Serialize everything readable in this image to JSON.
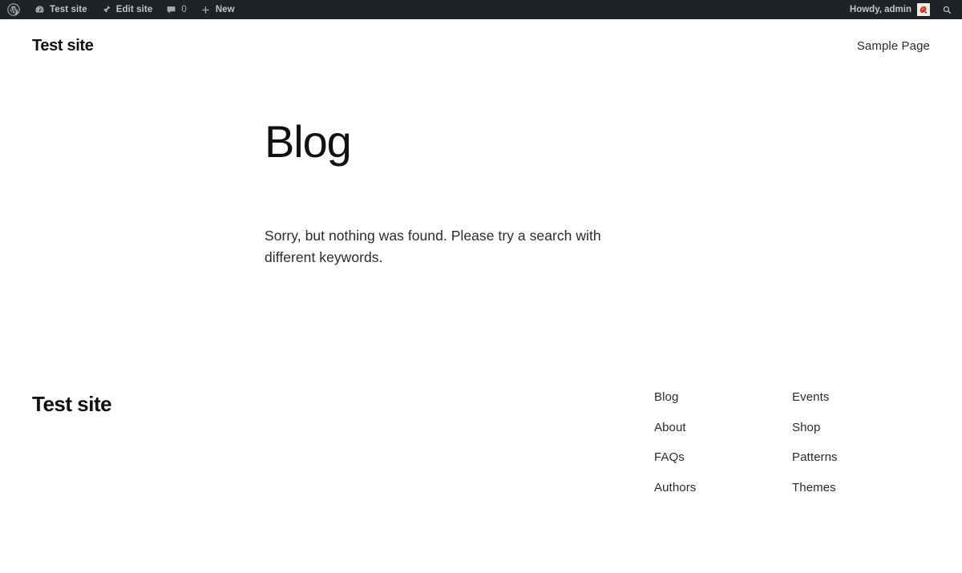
{
  "adminbar": {
    "wp_logo_label": "About WordPress",
    "items": [
      {
        "icon": "wordpress-logo-icon",
        "label": ""
      },
      {
        "icon": "dashboard-icon",
        "label": "Test site"
      },
      {
        "icon": "pushpin-icon",
        "label": "Edit site"
      },
      {
        "icon": "comment-bubble-icon",
        "label": "0"
      },
      {
        "icon": "plus-icon",
        "label": "New"
      }
    ],
    "site_name": "Test site",
    "edit_site": "Edit site",
    "comment_count": "0",
    "new_label": "New",
    "howdy": "Howdy, admin",
    "avatar_alt": "admin avatar",
    "search_icon": "search-icon",
    "background": "#1d2327",
    "text_color": "#c3c4c7"
  },
  "header": {
    "site_title": "Test site",
    "nav": [
      {
        "label": "Sample Page"
      }
    ]
  },
  "main": {
    "page_title": "Blog",
    "no_results": "Sorry, but nothing was found. Please try a search with different keywords."
  },
  "footer": {
    "site_title": "Test site",
    "columns": [
      {
        "links": [
          {
            "label": "Blog"
          },
          {
            "label": "About"
          },
          {
            "label": "FAQs"
          },
          {
            "label": "Authors"
          }
        ]
      },
      {
        "links": [
          {
            "label": "Events"
          },
          {
            "label": "Shop"
          },
          {
            "label": "Patterns"
          },
          {
            "label": "Themes"
          }
        ]
      }
    ]
  },
  "colors": {
    "page_background": "#ffffff",
    "text": "#1e1e1e",
    "muted_text": "#2b2b2b",
    "adminbar_bg": "#1d2327",
    "adminbar_text": "#c3c4c7",
    "avatar_accent": "#c0341d"
  }
}
